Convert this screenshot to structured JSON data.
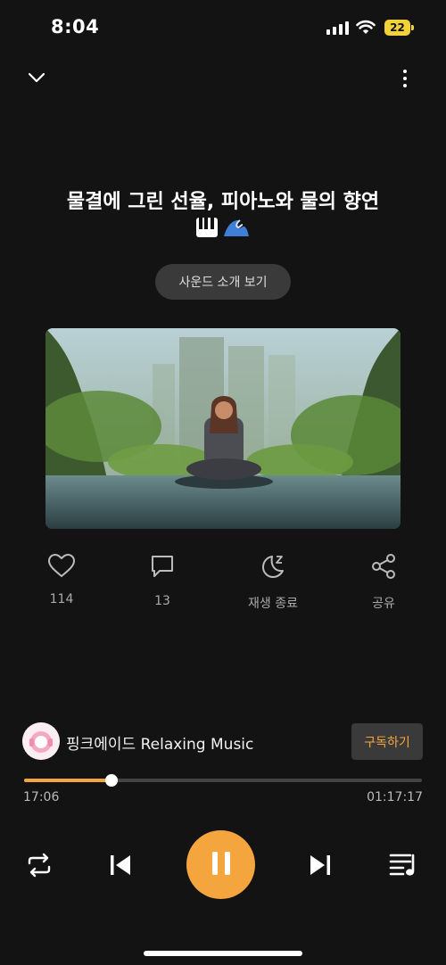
{
  "status": {
    "time": "8:04",
    "battery": "22"
  },
  "track": {
    "title": "물결에 그린 선율, 피아노와 물의 향연",
    "title_emojis": [
      "piano-emoji",
      "water-wave-emoji"
    ],
    "intro_button": "사운드 소개 보기"
  },
  "actions": {
    "likes": "114",
    "comments": "13",
    "sleep_timer": "재생 종료",
    "share": "공유"
  },
  "channel": {
    "name": "핑크에이드 Relaxing Music",
    "subscribe": "구독하기"
  },
  "progress": {
    "current": "17:06",
    "total": "01:17:17",
    "fraction": 0.22
  },
  "colors": {
    "accent": "#f5a53d",
    "background": "#131313",
    "battery": "#f2d23a"
  },
  "icons": [
    "chevron-down-icon",
    "more-vertical-icon",
    "heart-icon",
    "comment-icon",
    "moon-sleep-icon",
    "share-icon",
    "repeat-icon",
    "previous-icon",
    "pause-icon",
    "next-icon",
    "playlist-icon"
  ]
}
